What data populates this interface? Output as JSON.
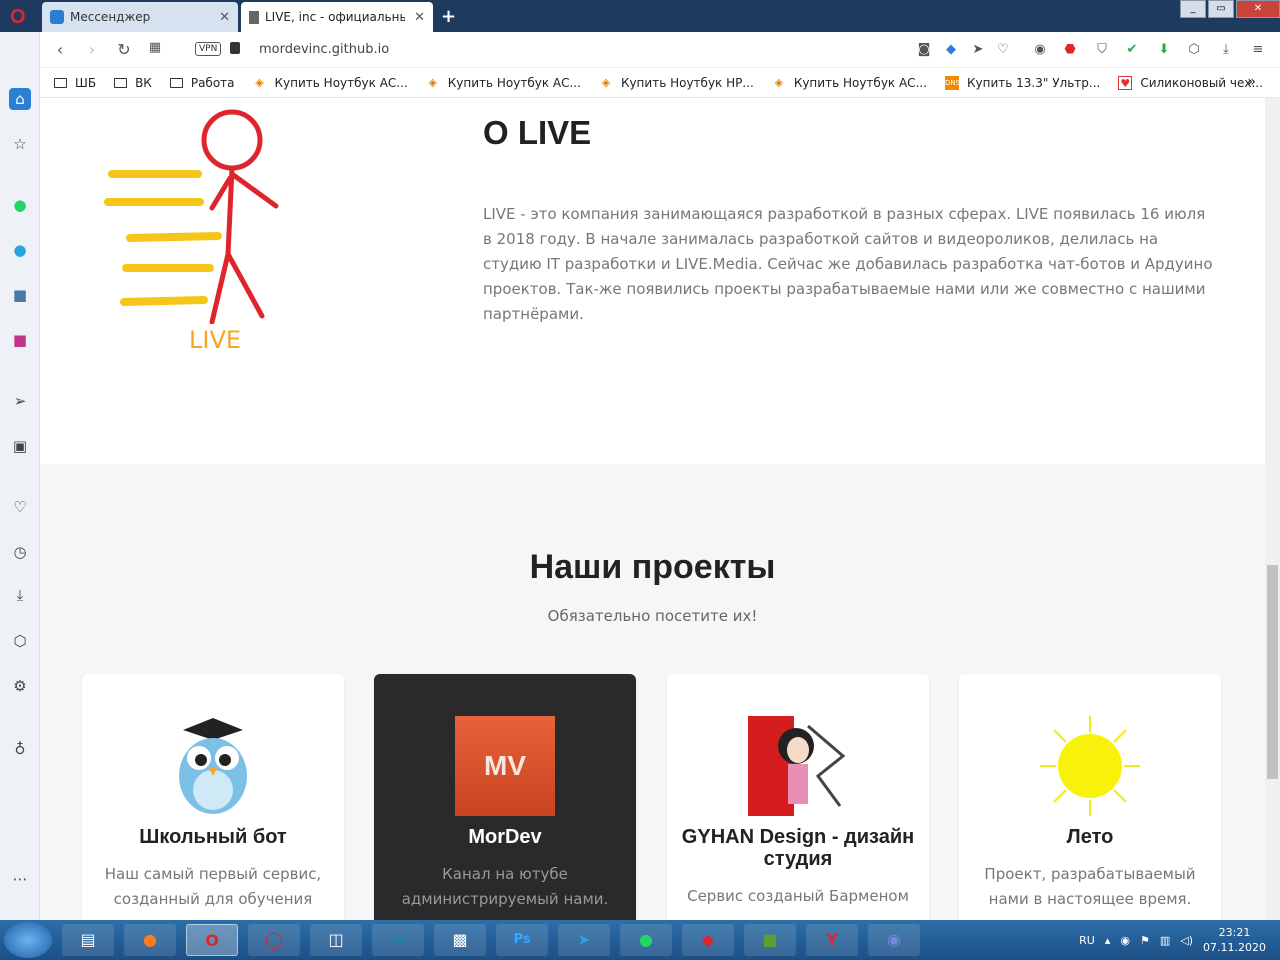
{
  "browser": {
    "tabs": [
      {
        "label": "Мессенджер"
      },
      {
        "label": "LIVE, inc - официальный с"
      }
    ],
    "new_tab_symbol": "+",
    "address": {
      "vpn": "VPN",
      "url": "mordevinc.github.io"
    },
    "bookmarks": [
      {
        "label": "ШБ",
        "icon": "folder-icon"
      },
      {
        "label": "ВК",
        "icon": "folder-icon"
      },
      {
        "label": "Работа",
        "icon": "folder-icon"
      },
      {
        "label": "Купить Ноутбук АС...",
        "icon": "price-tag-icon"
      },
      {
        "label": "Купить Ноутбук АС...",
        "icon": "price-tag-icon"
      },
      {
        "label": "Купить Ноутбук НР...",
        "icon": "price-tag-icon"
      },
      {
        "label": "Купить Ноутбук АС...",
        "icon": "price-tag-icon"
      },
      {
        "label": "Купить 13.3\" Ультр...",
        "icon": "dns-icon"
      },
      {
        "label": "Силиконовый чех...",
        "icon": "red-bookmark-icon"
      }
    ],
    "bookmarks_more": "»"
  },
  "about": {
    "title": "О LIVE",
    "text": "LIVE - это компания занимающаяся разработкой в разных сферах. LIVE появилась 16 июля в 2018 году. В начале занималась разработкой сайтов и видеороликов, делилась на студию IT разработки и LIVE.Media. Сейчас же добавилась разработка чат-ботов и Ардуино проектов. Так-же появились проекты разрабатываемые нами или же совместно с нашими партнёрами.",
    "logo_text": "LIVE"
  },
  "projects": {
    "title": "Наши проекты",
    "subtitle": "Обязательно посетите их!",
    "cards": [
      {
        "title": "Школьный бот",
        "desc": "Наш самый первый сервис, созданный для обучения",
        "icon": "owl-graduate-icon"
      },
      {
        "title": "MorDev",
        "desc": "Канал на ютубе администрируемый нами.",
        "icon": "mordev-logo-icon",
        "logo_text": "MV"
      },
      {
        "title": "GYHAN Design - дизайн студия",
        "desc": "Сервис созданый Барменом",
        "icon": "anime-art-icon"
      },
      {
        "title": "Лето",
        "desc": "Проект, разрабатываемый нами в настоящее время.",
        "icon": "sun-icon"
      }
    ]
  },
  "taskbar": {
    "lang": "RU",
    "time": "23:21",
    "date": "07.11.2020"
  },
  "colors": {
    "accent_red": "#e0242c",
    "live_yellow": "#f5c518",
    "dark_card": "#2a2a2a"
  }
}
